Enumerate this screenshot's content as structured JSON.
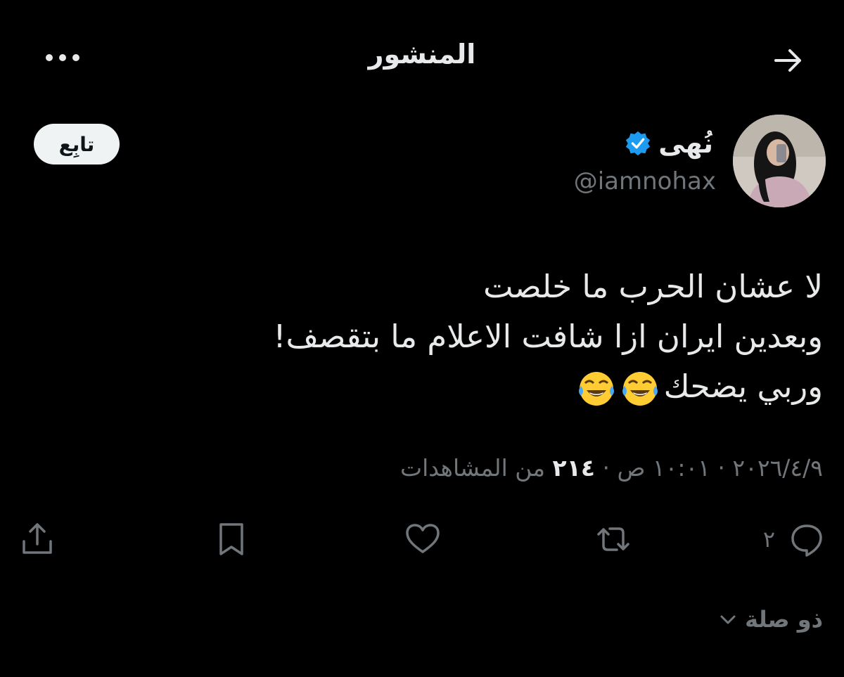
{
  "header": {
    "title": "المنشور",
    "back_icon": "arrow-right-icon",
    "more_icon": "more-horizontal-icon"
  },
  "author": {
    "display_name": "نُهى",
    "handle": "@iamnohax",
    "verified": true,
    "verified_color": "#1d9bf0",
    "follow_label": "تابِع"
  },
  "tweet": {
    "lines": [
      "لا عشان الحرب ما خلصت",
      "وبعدين ايران ازا شافت الاعلام ما بتقصف!",
      "وربي يضحك"
    ],
    "emojis": [
      "face-with-tears-of-joy",
      "face-with-tears-of-joy"
    ]
  },
  "meta": {
    "date": "٢٠٢٦/٤/٩",
    "time": "١٠:٠١ ص",
    "separator": "·",
    "views_count": "٢١٤",
    "views_label": "من المشاهدات"
  },
  "actions": {
    "reply_count": "٢",
    "reply_icon": "reply-icon",
    "retweet_icon": "retweet-icon",
    "like_icon": "heart-icon",
    "bookmark_icon": "bookmark-icon",
    "share_icon": "share-icon"
  },
  "sort": {
    "label": "ذو صلة"
  },
  "colors": {
    "background": "#000000",
    "primary_text": "#e7e9ea",
    "secondary_text": "#71767b",
    "accent": "#1d9bf0"
  }
}
